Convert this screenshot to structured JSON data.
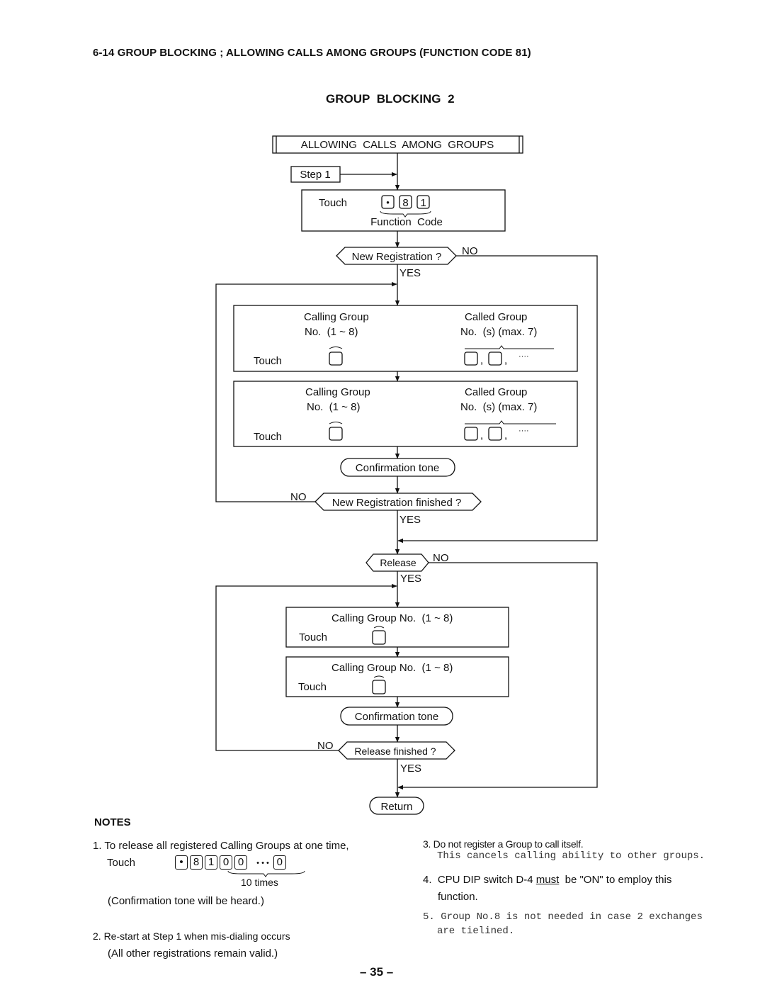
{
  "header": {
    "section_title": "6-14 GROUP BLOCKING ; ALLOWING CALLS AMONG GROUPS (FUNCTION CODE 81)",
    "subtitle": "GROUP  BLOCKING  2"
  },
  "flowchart": {
    "start_label": "ALLOWING  CALLS  AMONG  GROUPS",
    "step_label": "Step 1",
    "function_box": {
      "touch": "Touch",
      "keys": [
        "•",
        "8",
        "1"
      ],
      "caption": "Function  Code"
    },
    "decision_new_registration": "New Registration ?",
    "decision_new_registration_finished": "New Registration finished ?",
    "decision_release": "Release",
    "decision_release_finished": "Release finished ?",
    "yes": "YES",
    "no": "NO",
    "registration_boxes": [
      {
        "calling_label_1": "Calling Group",
        "calling_label_2": "No.  (1 ~ 8)",
        "called_label_1": "Called Group",
        "called_label_2": "No.  (s) (max. 7)",
        "touch": "Touch",
        "separator": ",",
        "ellipsis": "····"
      },
      {
        "calling_label_1": "Calling Group",
        "calling_label_2": "No.  (1 ~ 8)",
        "called_label_1": "Called Group",
        "called_label_2": "No.  (s) (max. 7)",
        "touch": "Touch",
        "separator": ",",
        "ellipsis": "····"
      }
    ],
    "release_boxes": [
      {
        "calling_label": "Calling Group No.  (1 ~ 8)",
        "touch": "Touch"
      },
      {
        "calling_label": "Calling Group No.  (1 ~ 8)",
        "touch": "Touch"
      }
    ],
    "confirmation_tone": "Confirmation tone",
    "return_label": "Return"
  },
  "notes": {
    "title": "NOTES",
    "note1": {
      "text": "1.  To release all registered Calling Groups at one time,",
      "touch": "Touch",
      "keys": [
        "•",
        "8",
        "1",
        "0",
        "0"
      ],
      "dots": "• • •",
      "last_key": "0",
      "repeat_caption": "10 times",
      "after": "(Confirmation tone will be heard.)"
    },
    "note2": {
      "line1": "2.  Re-start at Step 1 when mis-dialing occurs",
      "line2": "(All other registrations remain valid.)"
    },
    "note3": {
      "line1": "3.  Do not register a Group to call itself.",
      "line2": "This cancels calling ability to other groups."
    },
    "note4": {
      "prefix": "4.  CPU DIP switch D-4 ",
      "emphasis": "must",
      "suffix": "  be \"ON\" to employ this",
      "line2": "function."
    },
    "note5": {
      "line1": "5. Group No.8 is not needed in case 2 exchanges",
      "line2": "are tielined."
    }
  },
  "footer": {
    "page_number": "– 35 –"
  }
}
